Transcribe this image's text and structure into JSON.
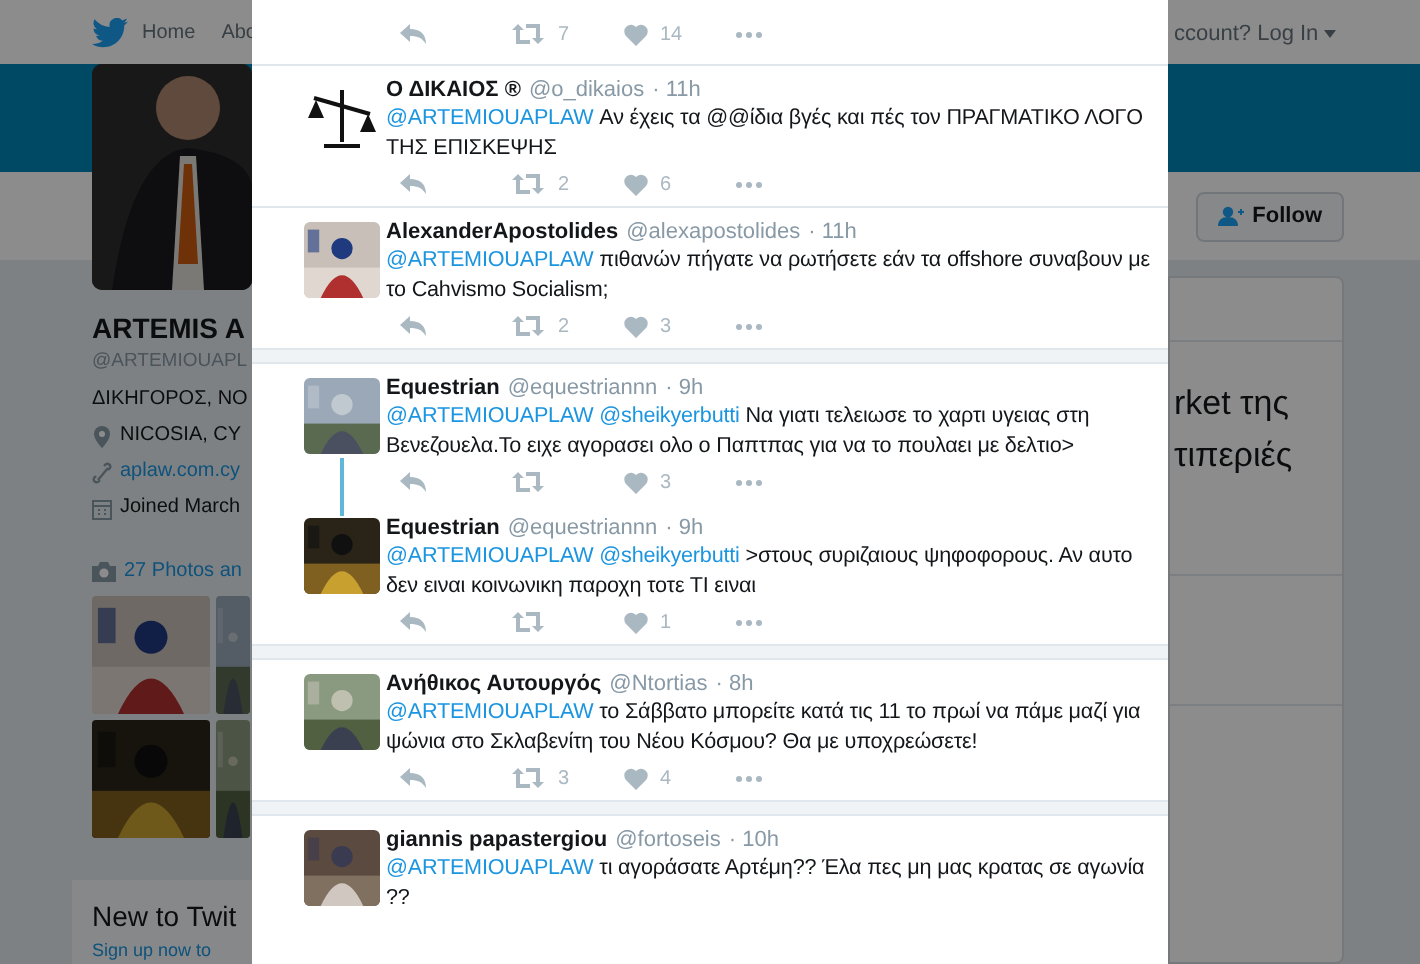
{
  "nav": {
    "home": "Home",
    "about": "Abo",
    "login": "ccount? Log In"
  },
  "profile": {
    "name": "ARTEMIS A",
    "handle": "@ARTEMIOUAPL",
    "bio": "ΔΙΚΗΓΟΡΟΣ, ΝΟ",
    "location": "NICOSIA, CY",
    "website": "aplaw.com.cy",
    "joined": "Joined March",
    "photos": "27 Photos an"
  },
  "follow_button": "Follow",
  "side_text": [
    "rket της",
    "τιπεριές"
  ],
  "signup": {
    "title": "New to Twit",
    "text": "Sign up now to"
  },
  "conversations": [
    {
      "threaded": false,
      "tweets": [
        {
          "kind": "partial",
          "retweets": "7",
          "likes": "14"
        },
        {
          "kind": "full",
          "avatar": {
            "kind": "icon"
          },
          "name": "Ο ΔΙΚΑΙΟΣ ®",
          "handle": "@o_dikaios",
          "time": "· 11h",
          "mentions": [
            "@ARTEMIOUAPLAW"
          ],
          "text": "Αν έχεις τα @@ίδια βγές και πές τον ΠΡΑΓΜΑΤΙΚΟ ΛΟΓΟ ΤΗΣ ΕΠΙΣΚΕΨΗΣ",
          "retweets": "2",
          "likes": "6"
        },
        {
          "kind": "full",
          "avatar": {
            "kind": "picture"
          },
          "name": "AlexanderApostolides",
          "handle": "@alexapostolides",
          "time": "· 11h",
          "mentions": [
            "@ARTEMIOUAPLAW"
          ],
          "text": "πιθανών πήγατε να ρωτήσετε εάν τα offshore συναβουν με το Cahvismo Socialism;",
          "retweets": "2",
          "likes": "3"
        }
      ]
    },
    {
      "threaded": true,
      "tweets": [
        {
          "kind": "full",
          "avatar": {
            "kind": "picture"
          },
          "name": "Equestrian",
          "handle": "@equestriannn",
          "time": "· 9h",
          "mentions": [
            "@ARTEMIOUAPLAW",
            "@sheikyerbutti"
          ],
          "text": "Να γιατι τελειωσε το χαρτι υγειας στη Βενεζουελα.Το ειχε αγορασει ολο ο Παπτπας για να το πουλαει με δελτιο>",
          "likes": "3"
        },
        {
          "kind": "full",
          "avatar": {
            "kind": "picture"
          },
          "name": "Equestrian",
          "handle": "@equestriannn",
          "time": "· 9h",
          "mentions": [
            "@ARTEMIOUAPLAW",
            "@sheikyerbutti"
          ],
          "text": ">στους συριζαιους ψηφοφορους. Αν αυτο δεν ειναι κοινωνικη παροχη τοτε ΤΙ ειναι",
          "likes": "1"
        }
      ]
    },
    {
      "tweets": [
        {
          "kind": "full",
          "avatar": {
            "kind": "picture"
          },
          "name": "Ανήθικος Αυτουργός",
          "handle": "@Ntortias",
          "time": "· 8h",
          "mentions": [
            "@ARTEMIOUAPLAW"
          ],
          "text": "το Σάββατο μπορείτε κατά τις 11 το πρωί να πάμε μαζί για ψώνια στο Σκλαβενίτη του Νέου Κόσμου? Θα με υποχρεώσετε!",
          "retweets": "3",
          "likes": "4"
        }
      ]
    },
    {
      "tweets": [
        {
          "kind": "full",
          "avatar": {
            "kind": "picture"
          },
          "name": "giannis papastergiou",
          "handle": "@fortoseis",
          "time": "· 10h",
          "mentions": [
            "@ARTEMIOUAPLAW"
          ],
          "text": "τι αγοράσατε Αρτέμη?? Έλα πες μη μας κρατας σε αγωνία ??"
        }
      ]
    }
  ]
}
